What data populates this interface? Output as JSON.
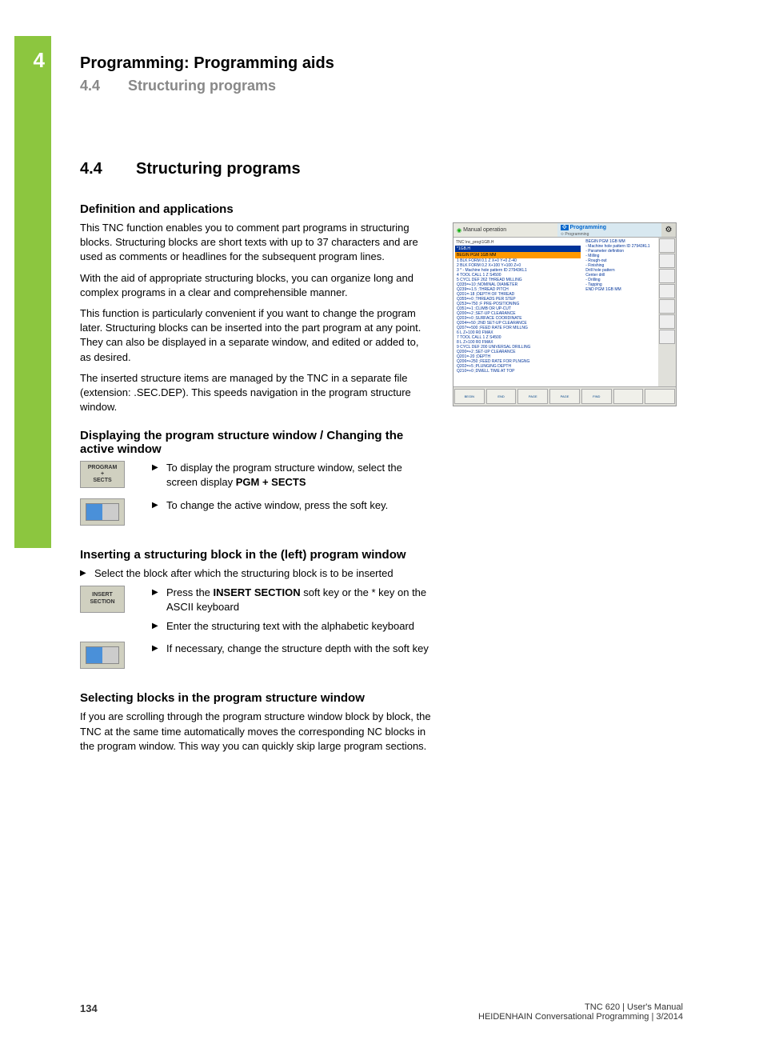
{
  "chapter": "4",
  "header": {
    "title": "Programming: Programming aids",
    "sub_num": "4.4",
    "sub_title": "Structuring programs"
  },
  "section": {
    "num": "4.4",
    "title": "Structuring programs"
  },
  "sub1": {
    "title": "Definition and applications",
    "p1": "This TNC function enables you to comment part programs in structuring blocks. Structuring blocks are short texts with up to 37 characters and are used as comments or headlines for the subsequent program lines.",
    "p2": "With the aid of appropriate structuring blocks, you can organize long and complex programs in a clear and comprehensible manner.",
    "p3": "This function is particularly convenient if you want to change the program later. Structuring blocks can be inserted into the part program at any point. They can also be displayed in a separate window, and edited or added to, as desired.",
    "p4": "The inserted structure items are managed by the TNC in a separate file (extension: .SEC.DEP). This speeds navigation in the program structure window."
  },
  "sub2": {
    "title": "Displaying the program structure window / Changing the active window",
    "sk1_line1": "PROGRAM",
    "sk1_line2": "+",
    "sk1_line3": "SECTS",
    "i1_pre": "To display the program structure window, select the screen display ",
    "i1_bold": "PGM + SECTS",
    "i2": "To change the active window, press the  soft key."
  },
  "sub3": {
    "title": "Inserting a structuring block in the (left) program window",
    "intro": "Select the block after which the structuring block is to be inserted",
    "sk_line1": "INSERT",
    "sk_line2": "SECTION",
    "i1_pre": "Press the ",
    "i1_bold": "INSERT SECTION",
    "i1_post": " soft key or the * key on the ASCII keyboard",
    "i2": "Enter the structuring text with the alphabetic keyboard",
    "i3": "If necessary, change the structure depth with the soft key"
  },
  "sub4": {
    "title": "Selecting blocks in the program structure window",
    "p1": "If you are scrolling through the program structure window block by block, the TNC at the same time automatically moves the corresponding NC blocks in the program window. This way you can quickly skip large program sections."
  },
  "screenshot": {
    "mode_left": "Manual operation",
    "mode_right": "Programming",
    "mode_right_sub": "Programming",
    "path": "TNC:\\nc_prog\\1GB.H",
    "hl1": "*1GB.H",
    "hl2": "BEGIN PGM 1GB MM",
    "lines_left": [
      "1  BLK FORM 0.1 Z X+0 Y+0 Z-40",
      "2  BLK FORM 0.2  X+100  Y+100  Z+0",
      "3  *   - Machine hole pattern ID 27943KL1",
      "4  TOOL CALL 1 Z S4500",
      "5  CYCL DEF 262 THREAD MILLING",
      "    Q335=+10   ;NOMINAL DIAMETER",
      "    Q239=+1.5  ;THREAD PITCH",
      "    Q201=-18   ;DEPTH OF THREAD",
      "    Q355=+0    ;THREADS PER STEP",
      "    Q253=+750  ;F PRE-POSITIONING",
      "    Q351=+1    ;CLIMB OR UP-CUT",
      "    Q200=+2    ;SET-UP CLEARANCE",
      "    Q203=+0    ;SURFACE COORDINATE",
      "    Q204=+50   ;2ND SET-UP CLEARANCE",
      "    Q207=+500  ;FEED RATE FOR MILLNG",
      "6  L  Z+100 R0 FMAX",
      "7  TOOL CALL 1 Z S4500",
      "8  L  Z+100 R0 FMAX",
      "9  CYCL DEF 200 UNIVERSAL DRILLING",
      "    Q200=+2    ;SET-UP CLEARANCE",
      "    Q201=-20   ;DEPTH",
      "    Q206=+250  ;FEED RATE FOR PLNGNG",
      "    Q202=+5    ;PLUNGING DEPTH",
      "    Q210=+0    ;DWELL TIME AT TOP"
    ],
    "lines_right": [
      "BEGIN PGM 1GB MM",
      "- Machine hole pattern ID 27943KL1",
      "- Parameter definition",
      "  - Milling",
      "  - Rough-out",
      "  - Finishing",
      "Drill hole pattern",
      "  Center drill",
      "  - Drilling",
      "  - Tapping",
      "END PGM 1GB MM"
    ],
    "softkeys": [
      "BEGIN",
      "END",
      "PAGE",
      "PAGE",
      "FIND",
      "",
      ""
    ]
  },
  "footer": {
    "page": "134",
    "line1": "TNC 620 | User's Manual",
    "line2": "HEIDENHAIN Conversational Programming | 3/2014"
  }
}
